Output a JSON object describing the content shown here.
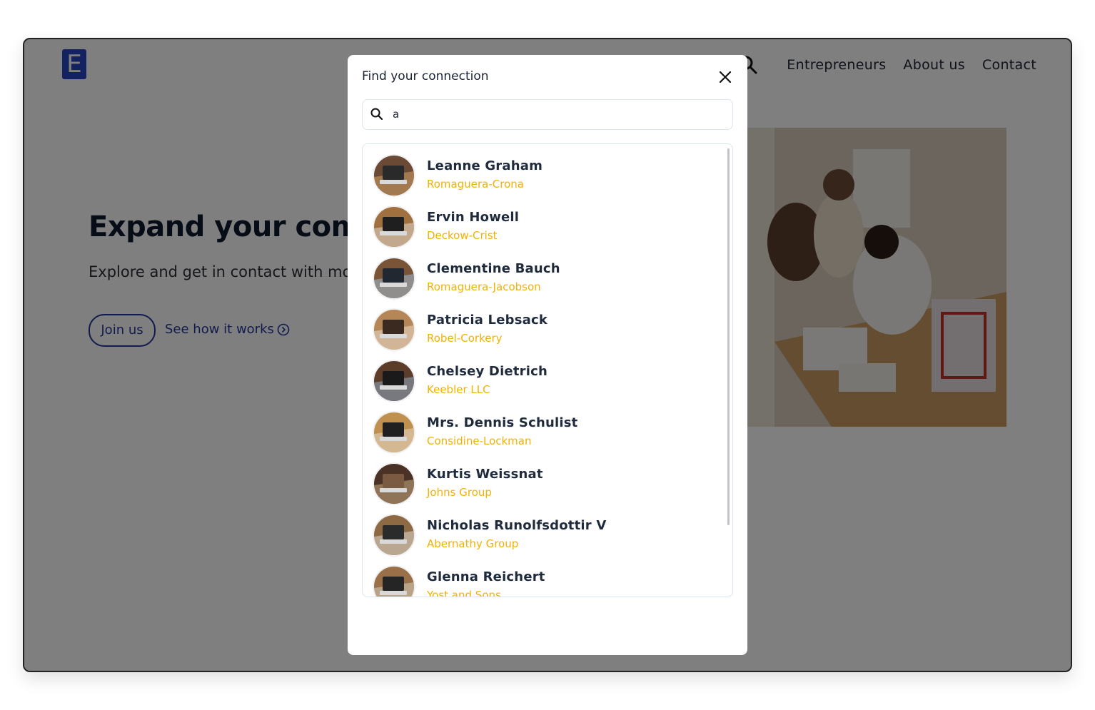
{
  "brand": {
    "logo_letter": "E",
    "color": "#2b45c4"
  },
  "nav": {
    "search_icon": "search-icon",
    "items": [
      "Entrepreneurs",
      "About us",
      "Contact"
    ]
  },
  "hero": {
    "title": "Expand your comm",
    "subtitle": "Explore and get in contact with mor you.",
    "join_label": "Join us",
    "how_label": "See how it works",
    "how_icon": "arrow-circle-right-icon",
    "accent": "#24369a"
  },
  "modal": {
    "title": "Find your connection",
    "close_icon": "close-icon",
    "search": {
      "value": "a",
      "icon": "search-icon"
    },
    "company_color": "#f2b200",
    "results": [
      {
        "name": "Leanne Graham",
        "company": "Romaguera-Crona"
      },
      {
        "name": "Ervin Howell",
        "company": "Deckow-Crist"
      },
      {
        "name": "Clementine Bauch",
        "company": "Romaguera-Jacobson"
      },
      {
        "name": "Patricia Lebsack",
        "company": "Robel-Corkery"
      },
      {
        "name": "Chelsey Dietrich",
        "company": "Keebler LLC"
      },
      {
        "name": "Mrs. Dennis Schulist",
        "company": "Considine-Lockman"
      },
      {
        "name": "Kurtis Weissnat",
        "company": "Johns Group"
      },
      {
        "name": "Nicholas Runolfsdottir V",
        "company": "Abernathy Group"
      },
      {
        "name": "Glenna Reichert",
        "company": "Yost and Sons"
      }
    ]
  }
}
